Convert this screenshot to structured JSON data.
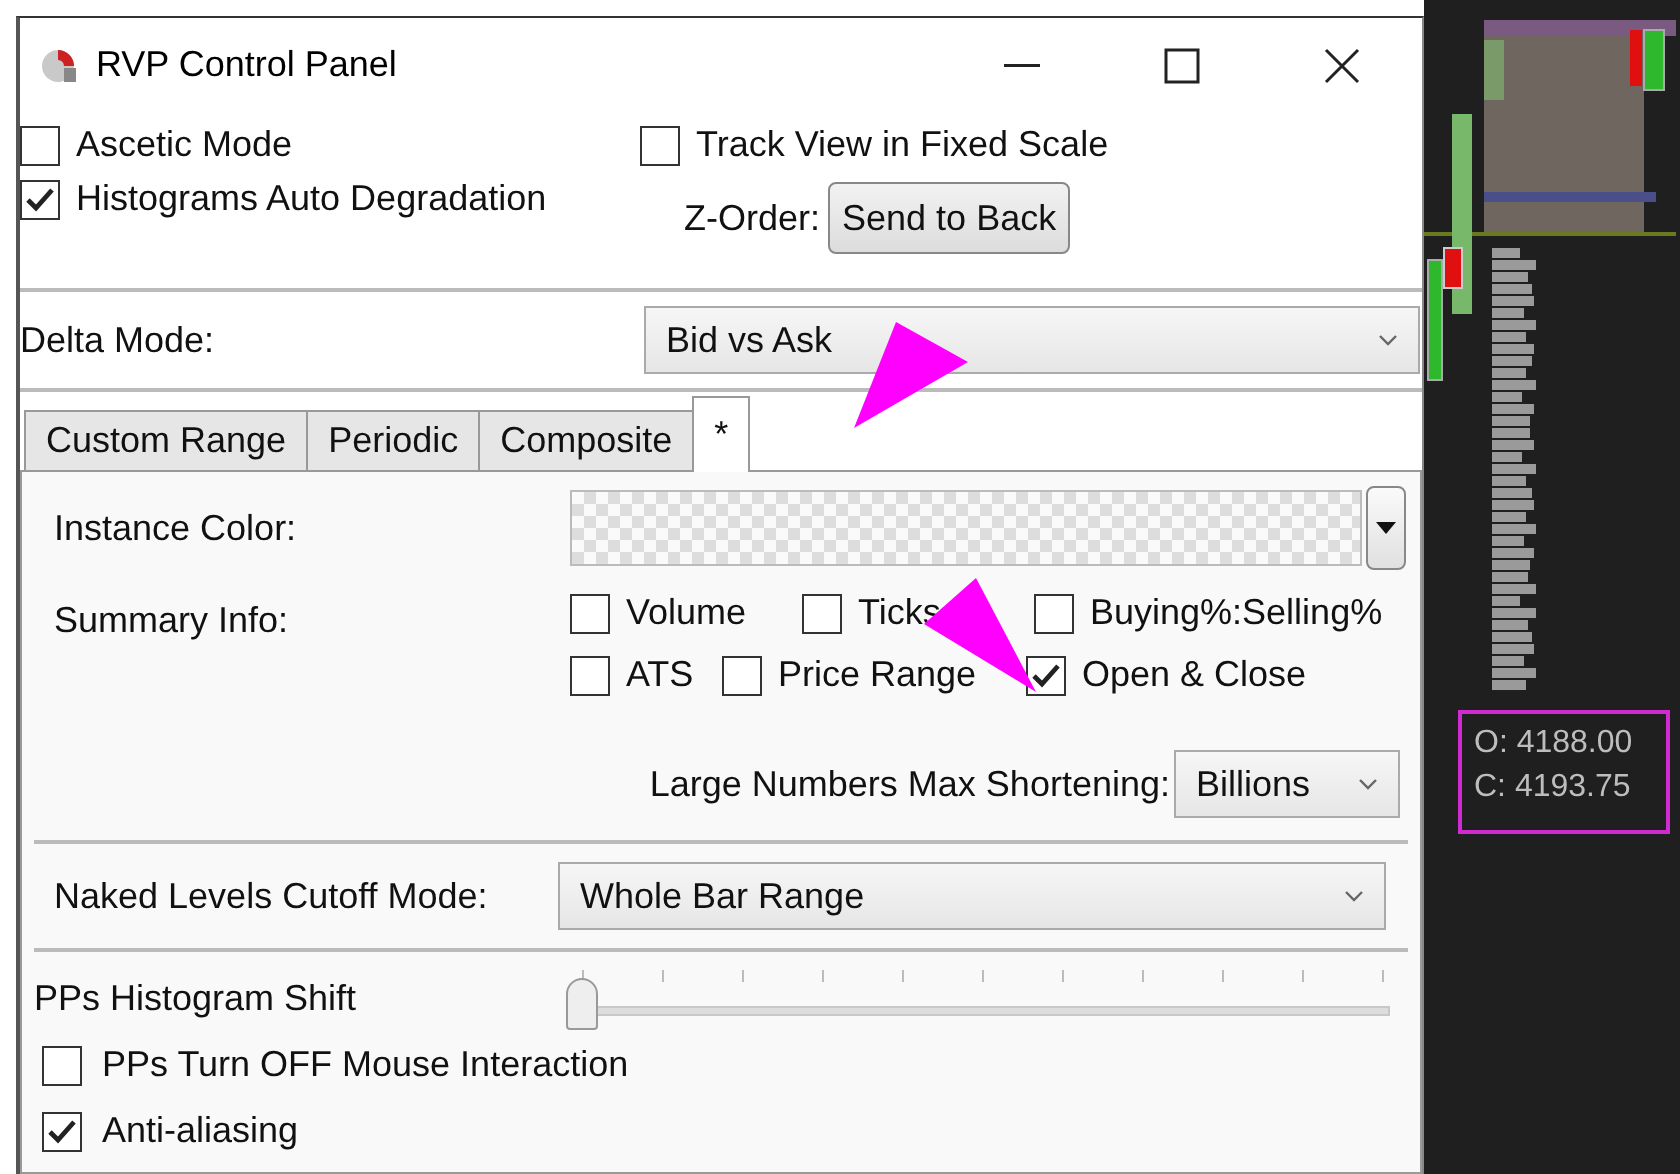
{
  "window": {
    "title": "RVP Control Panel"
  },
  "options": [
    {
      "label": "Ascetic Mode",
      "checked": false
    },
    {
      "label": "Track View in Fixed Scale",
      "checked": false
    },
    {
      "label": "Histograms Auto Degradation",
      "checked": true
    }
  ],
  "z_order": {
    "label": "Z-Order:",
    "button": "Send to Back"
  },
  "delta_mode": {
    "label": "Delta Mode:",
    "value": "Bid vs Ask"
  },
  "tabs": [
    {
      "label": "Custom Range",
      "selected": false
    },
    {
      "label": "Periodic",
      "selected": false
    },
    {
      "label": "Composite",
      "selected": false
    },
    {
      "label": "*",
      "selected": true
    }
  ],
  "instance_color": {
    "label": "Instance Color:"
  },
  "summary_info": {
    "label": "Summary Info:",
    "items": [
      {
        "label": "Volume",
        "checked": false
      },
      {
        "label": "Ticks",
        "checked": false
      },
      {
        "label": "Buying%:Selling%",
        "checked": false
      },
      {
        "label": "ATS",
        "checked": false
      },
      {
        "label": "Price Range",
        "checked": false
      },
      {
        "label": "Open & Close",
        "checked": true
      }
    ]
  },
  "large_numbers": {
    "label": "Large Numbers Max Shortening:",
    "value": "Billions"
  },
  "naked_levels": {
    "label": "Naked Levels Cutoff Mode:",
    "value": "Whole Bar Range"
  },
  "histogram_shift": {
    "label": "PPs Histogram Shift",
    "level": 0
  },
  "bottom_options": [
    {
      "label": "PPs Turn OFF Mouse Interaction",
      "checked": false
    },
    {
      "label": "Anti-aliasing",
      "checked": true
    }
  ],
  "chart_tooltip": {
    "lines": [
      "O: 4188.00",
      "C: 4193.75"
    ]
  }
}
